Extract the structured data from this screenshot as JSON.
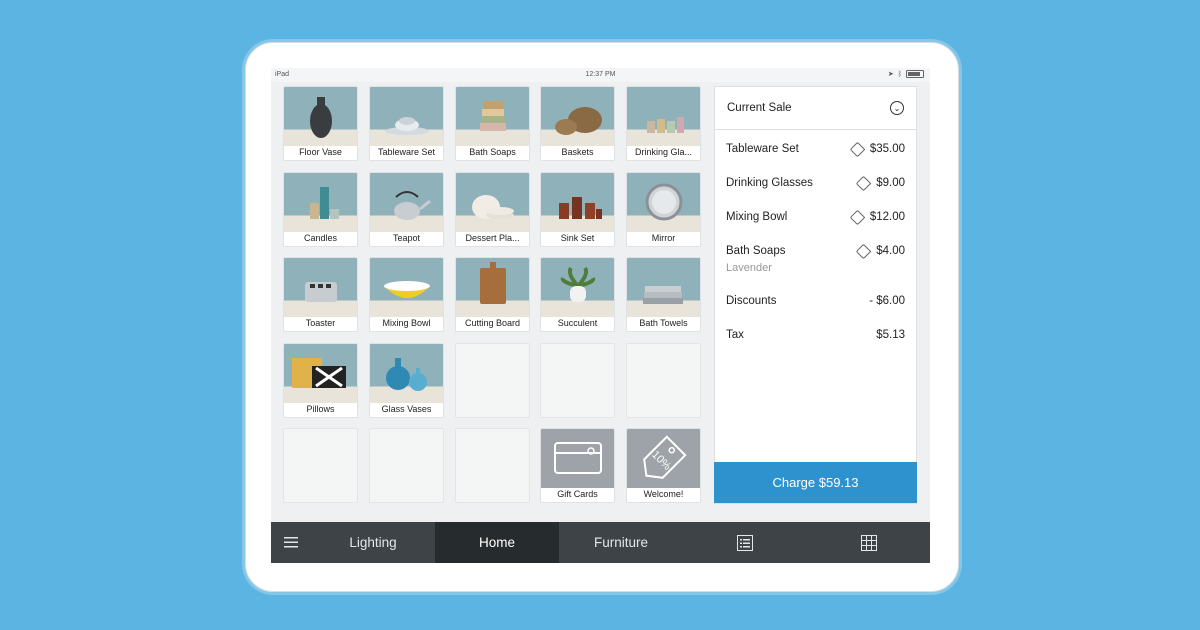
{
  "status": {
    "device": "iPad",
    "time": "12:37 PM"
  },
  "items": [
    {
      "label": "Floor Vase"
    },
    {
      "label": "Tableware Set"
    },
    {
      "label": "Bath Soaps"
    },
    {
      "label": "Baskets"
    },
    {
      "label": "Drinking Gla..."
    },
    {
      "label": "Candles"
    },
    {
      "label": "Teapot"
    },
    {
      "label": "Dessert Pla..."
    },
    {
      "label": "Sink Set"
    },
    {
      "label": "Mirror"
    },
    {
      "label": "Toaster"
    },
    {
      "label": "Mixing Bowl"
    },
    {
      "label": "Cutting Board"
    },
    {
      "label": "Succulent"
    },
    {
      "label": "Bath Towels"
    },
    {
      "label": "Pillows"
    },
    {
      "label": "Glass Vases"
    }
  ],
  "specials": {
    "gift_cards": "Gift Cards",
    "welcome": "Welcome!",
    "discount_text": "10%"
  },
  "sale": {
    "title": "Current Sale",
    "lines": [
      {
        "name": "Tableware Set",
        "amount": "$35.00"
      },
      {
        "name": "Drinking Glasses",
        "amount": "$9.00"
      },
      {
        "name": "Mixing Bowl",
        "amount": "$12.00"
      },
      {
        "name": "Bath Soaps",
        "amount": "$4.00",
        "variant": "Lavender"
      }
    ],
    "discounts_label": "Discounts",
    "discounts_amount": "- $6.00",
    "tax_label": "Tax",
    "tax_amount": "$5.13",
    "charge_label": "Charge $59.13"
  },
  "nav": {
    "lighting": "Lighting",
    "home": "Home",
    "furniture": "Furniture"
  }
}
